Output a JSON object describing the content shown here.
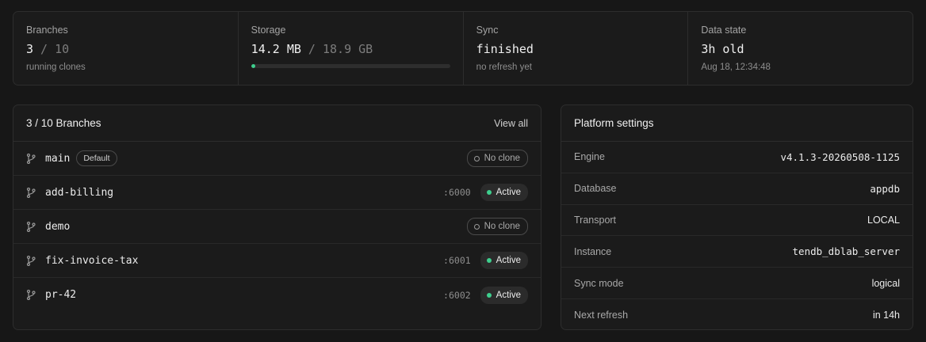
{
  "stats": {
    "branches": {
      "label": "Branches",
      "value": "3",
      "sep": " / ",
      "total": "10",
      "sub": "running clones"
    },
    "storage": {
      "label": "Storage",
      "value": "14.2 MB",
      "sep": " / ",
      "total": "18.9 GB",
      "progress_fraction": 0.0008,
      "progress_color": "#3ecf8e"
    },
    "sync": {
      "label": "Sync",
      "value": "finished",
      "sub": "no refresh yet"
    },
    "data_state": {
      "label": "Data state",
      "value": "3h old",
      "sub": "Aug 18, 12:34:48"
    }
  },
  "branches_panel": {
    "title": "3 / 10 Branches",
    "view_all": "View all",
    "rows": [
      {
        "name": "main",
        "badge": "Default",
        "port": "",
        "status": "No clone",
        "active": false
      },
      {
        "name": "add-billing",
        "badge": "",
        "port": ":6000",
        "status": "Active",
        "active": true
      },
      {
        "name": "demo",
        "badge": "",
        "port": "",
        "status": "No clone",
        "active": false
      },
      {
        "name": "fix-invoice-tax",
        "badge": "",
        "port": ":6001",
        "status": "Active",
        "active": true
      },
      {
        "name": "pr-42",
        "badge": "",
        "port": ":6002",
        "status": "Active",
        "active": true
      }
    ],
    "branch_icon": "git-branch-icon"
  },
  "settings_panel": {
    "title": "Platform settings",
    "rows": [
      {
        "key": "Engine",
        "value": "v4.1.3-20260508-1125",
        "mono": true
      },
      {
        "key": "Database",
        "value": "appdb",
        "mono": true
      },
      {
        "key": "Transport",
        "value": "LOCAL",
        "mono": false
      },
      {
        "key": "Instance",
        "value": "tendb_dblab_server",
        "mono": true
      },
      {
        "key": "Sync mode",
        "value": "logical",
        "mono": false
      },
      {
        "key": "Next refresh",
        "value": "in 14h",
        "mono": false
      }
    ]
  }
}
